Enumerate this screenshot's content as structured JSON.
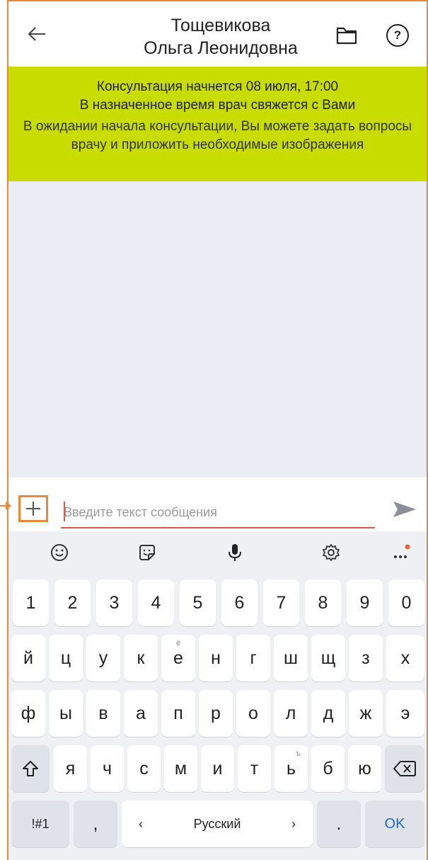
{
  "header": {
    "title_line1": "Тощевикова",
    "title_line2": "Ольга Леонидовна",
    "help_label": "?"
  },
  "banner": {
    "line1": "Консультация начнется 08 июля, 17:00",
    "line2": "В назначенное время врач свяжется с Вами",
    "line3": "В ожидании начала консультации, Вы можете задать вопросы врачу и приложить необходимые изображения"
  },
  "composer": {
    "placeholder": "Введите текст сообщения",
    "plus_label": "+"
  },
  "keyboard": {
    "numbers": [
      "1",
      "2",
      "3",
      "4",
      "5",
      "6",
      "7",
      "8",
      "9",
      "0"
    ],
    "row1": [
      "й",
      "ц",
      "у",
      "к",
      "е",
      "н",
      "г",
      "ш",
      "щ",
      "з",
      "х"
    ],
    "row1_alt_e": "ё",
    "row2": [
      "ф",
      "ы",
      "в",
      "а",
      "п",
      "р",
      "о",
      "л",
      "д",
      "ж",
      "э"
    ],
    "row3": [
      "я",
      "ч",
      "с",
      "м",
      "и",
      "т",
      "ь",
      "б",
      "ю"
    ],
    "row3_alt_soft": "ъ",
    "symbols_label": "!#1",
    "comma": ",",
    "lang_left": "‹",
    "lang_label": "Русский",
    "lang_right": "›",
    "period": ".",
    "ok_label": "OK"
  },
  "colors": {
    "accent": "#e8883a",
    "banner": "#c8dc00",
    "chat_bg": "#ebedf5",
    "input_underline": "#d95a4a",
    "ok_blue": "#1d6fd6"
  }
}
